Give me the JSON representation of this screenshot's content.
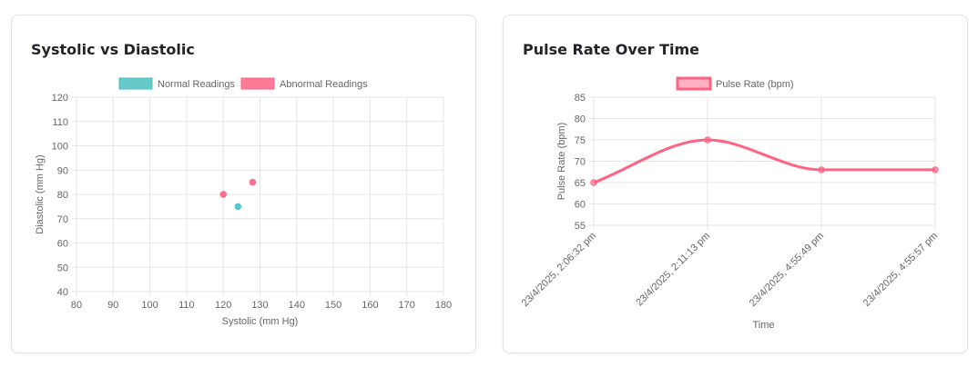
{
  "cards": [
    {
      "title": "Systolic vs Diastolic"
    },
    {
      "title": "Pulse Rate Over Time"
    }
  ],
  "colors": {
    "normal": "#4bc0c0",
    "abnormal": "#ff6384",
    "grid": "#e5e5e5",
    "tick": "#666666"
  },
  "chart_data": [
    {
      "type": "scatter",
      "title": "",
      "xlabel": "Systolic (mm Hg)",
      "ylabel": "Diastolic (mm Hg)",
      "xlim": [
        80,
        180
      ],
      "ylim": [
        40,
        120
      ],
      "xticks": [
        80,
        90,
        100,
        110,
        120,
        130,
        140,
        150,
        160,
        170,
        180
      ],
      "yticks": [
        40,
        50,
        60,
        70,
        80,
        90,
        100,
        110,
        120
      ],
      "legend_position": "top",
      "grid": true,
      "series": [
        {
          "name": "Normal Readings",
          "color": "#4bc0c0",
          "points": [
            {
              "x": 124,
              "y": 75
            }
          ]
        },
        {
          "name": "Abnormal Readings",
          "color": "#ff6384",
          "points": [
            {
              "x": 120,
              "y": 80
            },
            {
              "x": 128,
              "y": 85
            }
          ]
        }
      ]
    },
    {
      "type": "line",
      "title": "",
      "xlabel": "Time",
      "ylabel": "Pulse Rate (bpm)",
      "ylim": [
        55,
        85
      ],
      "yticks": [
        55,
        60,
        65,
        70,
        75,
        80,
        85
      ],
      "legend_position": "top",
      "grid": true,
      "categories": [
        "23/4/2025, 2:06:32 pm",
        "23/4/2025, 2:11:13 pm",
        "23/4/2025, 4:55:49 pm",
        "23/4/2025, 4:55:57 pm"
      ],
      "series": [
        {
          "name": "Pulse Rate (bpm)",
          "color": "#ff6384",
          "values": [
            65,
            75,
            68,
            68
          ]
        }
      ]
    }
  ]
}
